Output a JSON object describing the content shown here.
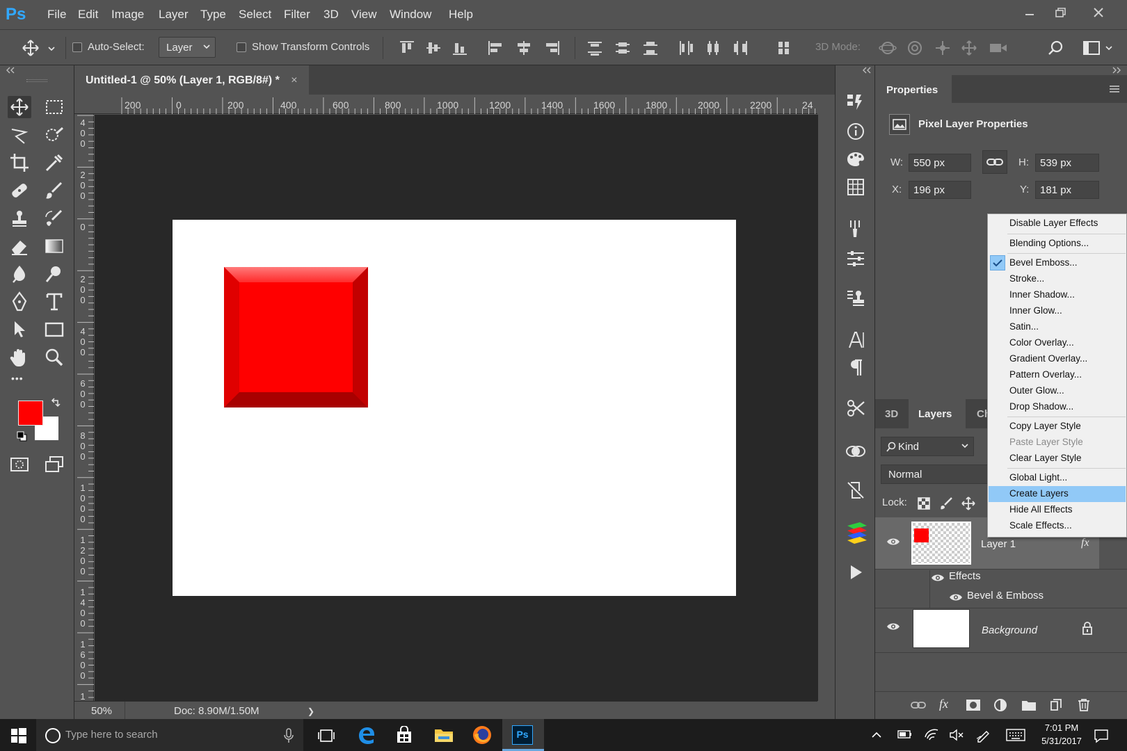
{
  "app": {
    "logo": "Ps"
  },
  "menu": {
    "items": [
      "File",
      "Edit",
      "Image",
      "Layer",
      "Type",
      "Select",
      "Filter",
      "3D",
      "View",
      "Window",
      "Help"
    ]
  },
  "options": {
    "auto_select_label": "Auto-Select:",
    "auto_select_value": "Layer",
    "show_transform_label": "Show Transform Controls",
    "mode_3d_label": "3D Mode:"
  },
  "document": {
    "tab_title": "Untitled-1 @ 50% (Layer 1, RGB/8#) *",
    "close_glyph": "×",
    "ruler_top": [
      "200",
      "0",
      "200",
      "400",
      "600",
      "800",
      "1000",
      "1200",
      "1400",
      "1600",
      "1800",
      "2000",
      "2200",
      "24"
    ],
    "ruler_left": [
      "4\n0\n0",
      "2\n0\n0",
      "0",
      "2\n0\n0",
      "4\n0\n0",
      "6\n0\n0",
      "8\n0\n0",
      "1\n0\n0\n0",
      "1\n2\n0\n0",
      "1\n4\n0\n0",
      "1\n6\n0\n0",
      "1"
    ],
    "zoom": "50%",
    "doc_size": "Doc: 8.90M/1.50M",
    "status_arrow": "❯",
    "square_color": "#ff0000"
  },
  "toolbar": {
    "fg_color": "#ff0000",
    "bg_color": "#ffffff",
    "more": "•••"
  },
  "properties": {
    "tab": "Properties",
    "heading": "Pixel Layer Properties",
    "w_label": "W:",
    "w_value": "550 px",
    "h_label": "H:",
    "h_value": "539 px",
    "x_label": "X:",
    "x_value": "196 px",
    "y_label": "Y:",
    "y_value": "181 px"
  },
  "layers": {
    "tabs": [
      "3D",
      "Layers",
      "Ch"
    ],
    "kind_label": "Kind",
    "blend_mode": "Normal",
    "lock_label": "Lock:",
    "layer1": "Layer 1",
    "fx": "fx",
    "effects": "Effects",
    "bevel": "Bevel & Emboss",
    "background": "Background"
  },
  "context_menu": {
    "items": [
      {
        "label": "Disable Layer Effects",
        "state": "normal"
      },
      {
        "label": "Blending Options...",
        "state": "normal"
      },
      {
        "label": "Bevel  Emboss...",
        "state": "checked"
      },
      {
        "label": "Stroke...",
        "state": "normal"
      },
      {
        "label": "Inner Shadow...",
        "state": "normal"
      },
      {
        "label": "Inner Glow...",
        "state": "normal"
      },
      {
        "label": "Satin...",
        "state": "normal"
      },
      {
        "label": "Color Overlay...",
        "state": "normal"
      },
      {
        "label": "Gradient Overlay...",
        "state": "normal"
      },
      {
        "label": "Pattern Overlay...",
        "state": "normal"
      },
      {
        "label": "Outer Glow...",
        "state": "normal"
      },
      {
        "label": "Drop Shadow...",
        "state": "normal"
      },
      {
        "label": "Copy Layer Style",
        "state": "normal"
      },
      {
        "label": "Paste Layer Style",
        "state": "disabled"
      },
      {
        "label": "Clear Layer Style",
        "state": "normal"
      },
      {
        "label": "Global Light...",
        "state": "normal"
      },
      {
        "label": "Create Layers",
        "state": "highlighted"
      },
      {
        "label": "Hide All Effects",
        "state": "normal"
      },
      {
        "label": "Scale Effects...",
        "state": "normal"
      }
    ]
  },
  "taskbar": {
    "search_placeholder": "Type here to search",
    "ps_label": "Ps",
    "time": "7:01 PM",
    "date": "5/31/2017"
  }
}
